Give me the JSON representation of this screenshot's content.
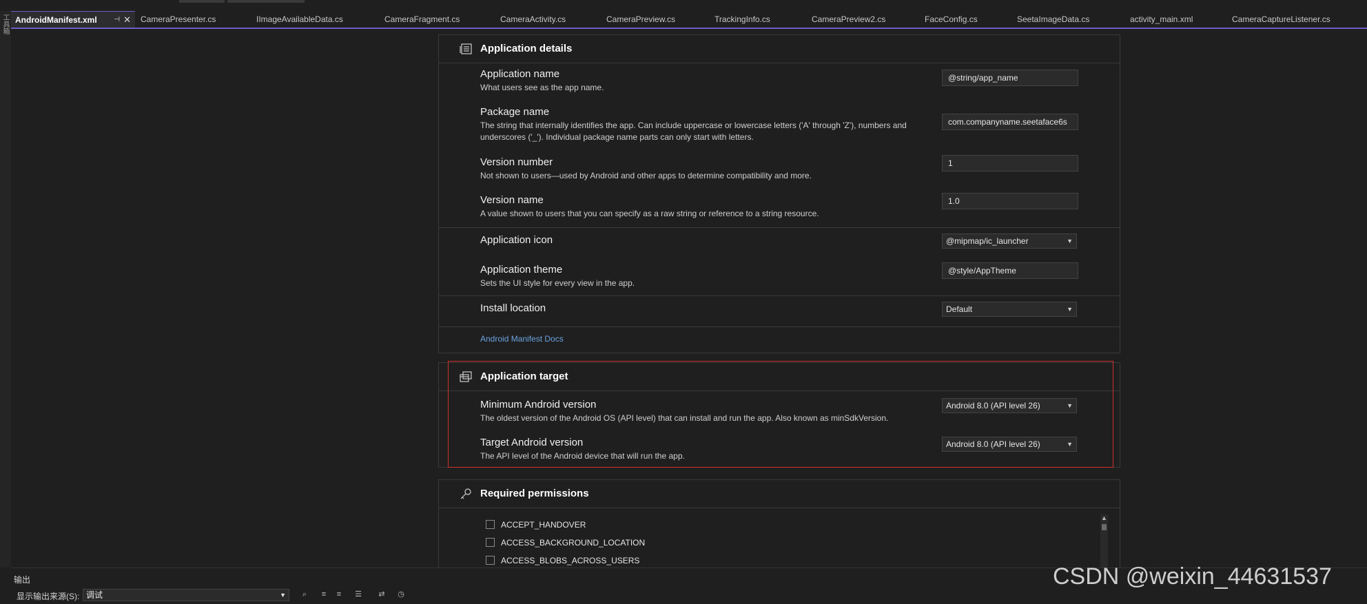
{
  "tabs": [
    {
      "label": "AndroidManifest.xml",
      "active": true
    },
    {
      "label": "CameraPresenter.cs"
    },
    {
      "label": "IImageAvailableData.cs"
    },
    {
      "label": "CameraFragment.cs"
    },
    {
      "label": "CameraActivity.cs"
    },
    {
      "label": "CameraPreview.cs"
    },
    {
      "label": "TrackingInfo.cs"
    },
    {
      "label": "CameraPreview2.cs"
    },
    {
      "label": "FaceConfig.cs"
    },
    {
      "label": "SeetaImageData.cs"
    },
    {
      "label": "activity_main.xml"
    },
    {
      "label": "CameraCaptureListener.cs"
    }
  ],
  "left_rail_label": "工具箱",
  "application_details": {
    "title": "Application details",
    "app_name": {
      "label": "Application name",
      "desc": "What users see as the app name.",
      "value": "@string/app_name"
    },
    "package_name": {
      "label": "Package name",
      "desc": "The string that internally identifies the app. Can include uppercase or lowercase letters ('A' through 'Z'), numbers and underscores ('_'). Individual package name parts can only start with letters.",
      "value": "com.companyname.seetaface6s"
    },
    "version_number": {
      "label": "Version number",
      "desc": "Not shown to users—used by Android and other apps to determine compatibility and more.",
      "value": "1"
    },
    "version_name": {
      "label": "Version name",
      "desc": "A value shown to users that you can specify as a raw string or reference to a string resource.",
      "value": "1.0"
    },
    "app_icon": {
      "label": "Application icon",
      "value": "@mipmap/ic_launcher"
    },
    "app_theme": {
      "label": "Application theme",
      "desc": "Sets the UI style for every view in the app.",
      "value": "@style/AppTheme"
    },
    "install_location": {
      "label": "Install location",
      "value": "Default"
    },
    "docs_link": "Android Manifest Docs"
  },
  "application_target": {
    "title": "Application target",
    "min_version": {
      "label": "Minimum Android version",
      "desc": "The oldest version of the Android OS (API level) that can install and run the app. Also known as minSdkVersion.",
      "value": "Android 8.0 (API level 26)"
    },
    "target_version": {
      "label": "Target Android version",
      "desc": "The API level of the Android device that will run the app.",
      "value": "Android 8.0 (API level 26)"
    }
  },
  "required_permissions": {
    "title": "Required permissions",
    "items": [
      "ACCEPT_HANDOVER",
      "ACCESS_BACKGROUND_LOCATION",
      "ACCESS_BLOBS_ACROSS_USERS"
    ]
  },
  "output_panel": {
    "title": "输出",
    "source_label": "显示输出来源(S):",
    "source_value": "调试"
  },
  "watermark": "CSDN @weixin_44631537",
  "colors": {
    "accent": "#6b5fc7",
    "link": "#6ba3e0",
    "highlight": "#d0312d"
  }
}
